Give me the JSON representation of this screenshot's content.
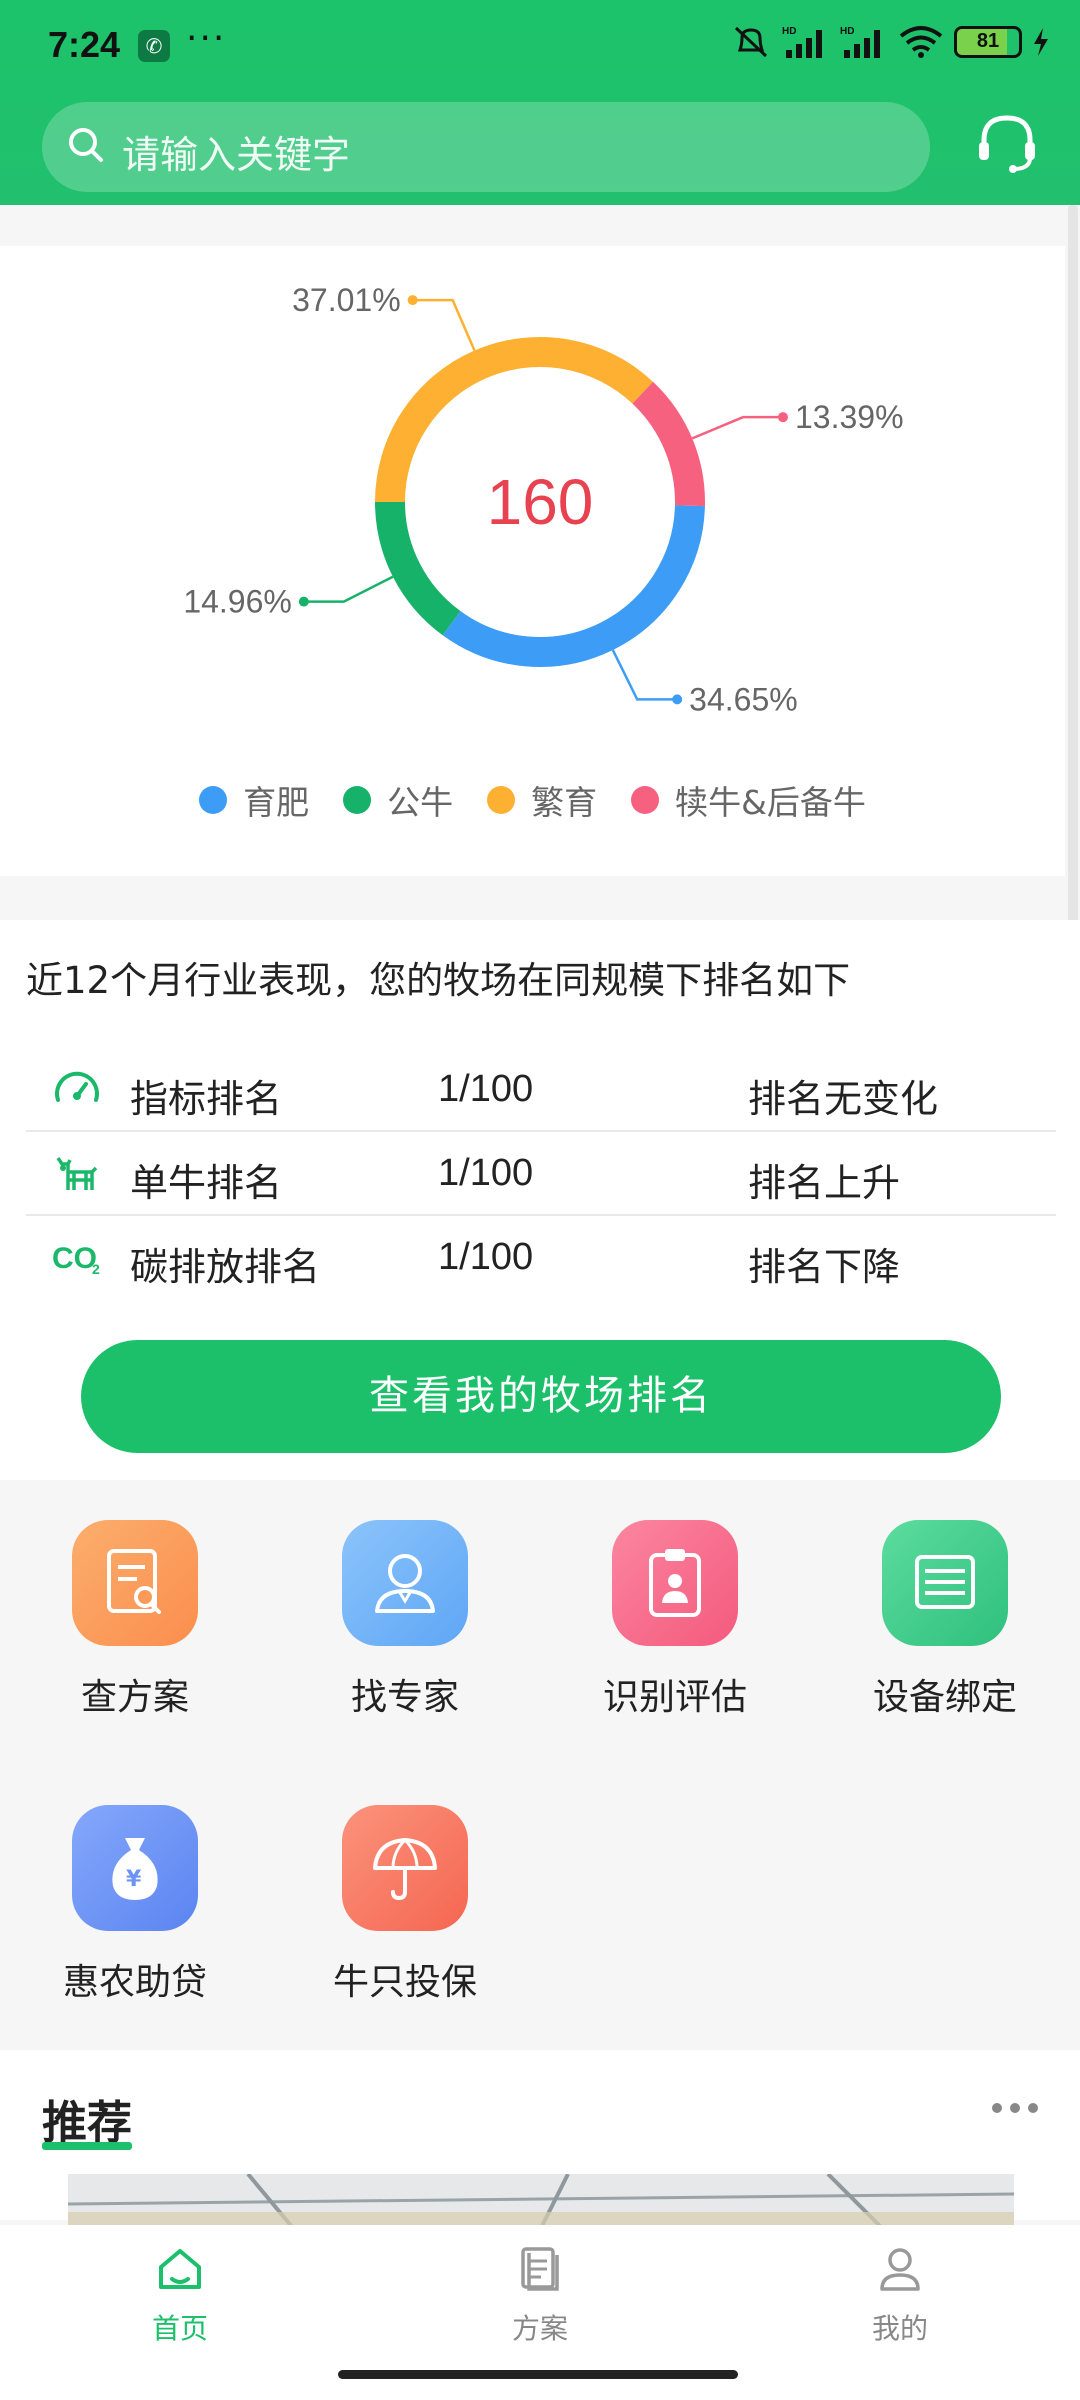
{
  "status_bar": {
    "time": "7:24",
    "battery": "81",
    "battery_level": 0.81
  },
  "search": {
    "placeholder": "请输入关键字"
  },
  "chart_data": {
    "type": "pie",
    "center_label": "160",
    "slices": [
      {
        "name": "育肥",
        "value": 34.65,
        "label": "34.65%",
        "color": "#3d9cf6"
      },
      {
        "name": "公牛",
        "value": 14.96,
        "label": "14.96%",
        "color": "#17b26a"
      },
      {
        "name": "繁育",
        "value": 37.01,
        "label": "37.01%",
        "color": "#fdb031"
      },
      {
        "name": "犊牛&后备牛",
        "value": 13.39,
        "label": "13.39%",
        "color": "#f76180"
      }
    ],
    "legend_placement": "bottom"
  },
  "ranking": {
    "title": "近12个月行业表现，您的牧场在同规模下排名如下",
    "rows": [
      {
        "name": "指标排名",
        "value": "1/100",
        "status": "排名无变化",
        "icon": "gauge-icon"
      },
      {
        "name": "单牛排名",
        "value": "1/100",
        "status": "排名上升",
        "icon": "cow-icon"
      },
      {
        "name": "碳排放排名",
        "value": "1/100",
        "status": "排名下降",
        "icon": "co2-icon"
      }
    ],
    "button_label": "查看我的牧场排名"
  },
  "services": [
    {
      "label": "查方案",
      "icon": "document-search-icon",
      "color": "#fb9d57"
    },
    {
      "label": "找专家",
      "icon": "expert-icon",
      "color": "#6fb2f8"
    },
    {
      "label": "识别评估",
      "icon": "clipboard-icon",
      "color": "#f86a8a"
    },
    {
      "label": "设备绑定",
      "icon": "device-icon",
      "color": "#3fcf8a"
    },
    {
      "label": "惠农助贷",
      "icon": "money-bag-icon",
      "color": "#6d94f5"
    },
    {
      "label": "牛只投保",
      "icon": "umbrella-icon",
      "color": "#fa7a63"
    }
  ],
  "recommend": {
    "title": "推荐"
  },
  "tabbar": [
    {
      "label": "首页",
      "icon": "home-icon",
      "active": true
    },
    {
      "label": "方案",
      "icon": "document-icon",
      "active": false
    },
    {
      "label": "我的",
      "icon": "user-icon",
      "active": false
    }
  ],
  "colors": {
    "primary": "#1cc06b",
    "inactive": "#999999"
  }
}
